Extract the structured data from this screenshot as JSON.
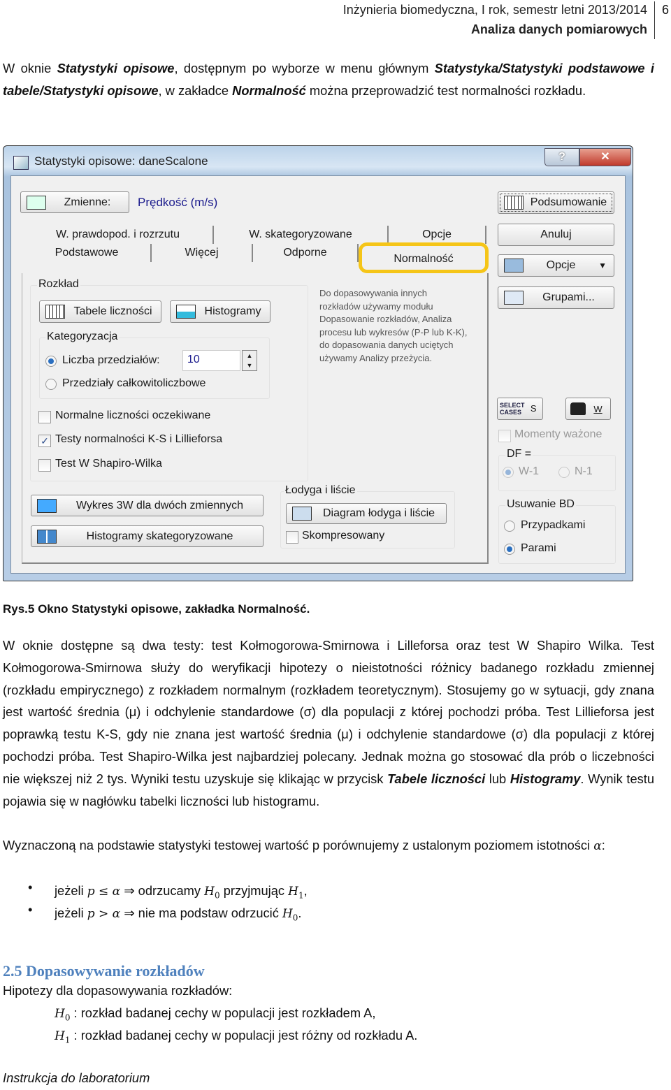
{
  "header": {
    "line1": "Inżynieria biomedyczna, I rok, semestr letni 2013/2014",
    "line2": "Analiza danych pomiarowych",
    "page_number": "6"
  },
  "para1": [
    "W oknie ",
    "Statystyki opisowe",
    ", dostępnym po wyborze w menu głównym ",
    "Statystyka/Statystyki podstawowe i tabele/Statystyki opisowe",
    ", w zakładce ",
    "Normalność",
    " można przeprowadzić test normalności rozkładu."
  ],
  "dialog": {
    "title": "Statystyki opisowe: daneScalone",
    "help": "?",
    "close": "✕",
    "variables_button": "Zmienne:",
    "variable_value": "Prędkość (m/s)",
    "tabs_row1": [
      "W. prawdopod. i rozrzutu",
      "W. skategoryzowane",
      "Opcje"
    ],
    "tabs_row2": [
      "Podstawowe",
      "Więcej",
      "Odporne",
      "Normalność"
    ],
    "active_tab": "Normalność",
    "highlight_color": "#f5c518",
    "group_distribution": "Rozkład",
    "freq_tables_button": "Tabele liczności",
    "histograms_button": "Histogramy",
    "group_categorization": "Kategoryzacja",
    "radio_intervals": "Liczba przedziałów:",
    "intervals_value": "10",
    "radio_integer": "Przedziały całkowitoliczbowe",
    "cb_expected": "Normalne liczności oczekiwane",
    "cb_expected_checked": false,
    "cb_ks": "Testy normalności  K-S i Lillieforsa",
    "cb_ks_checked": true,
    "cb_sw": "Test W Shapiro-Wilka",
    "cb_sw_checked": false,
    "info": "Do dopasowywania innych rozkładów używamy modułu Dopasowanie rozkładów, Analiza procesu lub wykresów (P-P lub K-K), do dopasowania danych uciętych używamy Analizy przeżycia.",
    "plot3d_button": "Wykres 3W  dla dwóch zmiennych",
    "cat_hist_button": "Histogramy skategoryzowane",
    "group_stem": "Łodyga i liście",
    "stem_button": "Diagram łodyga i liście",
    "cb_compressed": "Skompresowany",
    "summary_button": "Podsumowanie",
    "cancel_button": "Anuluj",
    "options_button": "Opcje",
    "bygroup_button": "Grupami...",
    "select_cases": [
      "SELECT",
      "CASES",
      "S"
    ],
    "weights_label": "W",
    "cb_moments": "Momenty ważone",
    "df_label": "DF =",
    "df_options": [
      "W-1",
      "N-1"
    ],
    "group_md": "Usuwanie BD",
    "md_options": [
      "Przypadkami",
      "Parami"
    ],
    "md_selected": "Parami"
  },
  "caption": "Rys.5 Okno Statystyki opisowe, zakładka Normalność.",
  "para2": [
    "W oknie dostępne są dwa testy: test Kołmogorowa-Smirnowa i Lilleforsa oraz test W Shapiro Wilka.  Test Kołmogorowa-Smirnowa służy do weryfikacji hipotezy o nieistotności różnicy badanego rozkładu zmiennej (rozkładu empirycznego) z rozkładem normalnym (rozkładem teoretycznym). Stosujemy go w sytuacji, gdy znana jest wartość średnia (μ) i odchylenie standardowe (σ) dla populacji z której pochodzi próba. Test Lillieforsa  jest poprawką testu K-S, gdy nie znana jest wartość średnia (μ) i odchylenie standardowe (σ) dla populacji z której pochodzi próba. Test Shapiro-Wilka jest najbardziej polecany. Jednak można go stosować dla prób o liczebności nie większej niż 2 tys. Wyniki testu uzyskuje się klikając w przycisk ",
    "Tabele liczności",
    " lub ",
    "Histogramy",
    ". Wynik testu pojawia się w nagłówku tabelki liczności lub histogramu."
  ],
  "para3": [
    "Wyznaczoną na podstawie statystyki testowej wartość p porównujemy z ustalonym poziomem istotności ",
    "α",
    ":"
  ],
  "bullets": [
    [
      "jeżeli ",
      "p ≤ α",
      " ⇒ odrzucamy ",
      "H",
      "0",
      " przyjmując ",
      "H",
      "1",
      ","
    ],
    [
      "jeżeli ",
      "p > α",
      " ⇒ nie ma podstaw odrzucić ",
      "H",
      "0",
      "."
    ]
  ],
  "section_heading": "2.5 Dopasowywanie rozkładów",
  "heading_color": "#4f81bd",
  "hypotheses_intro": "Hipotezy dla dopasowywania rozkładów:",
  "hypotheses": [
    {
      "sym": "H",
      "sub": "0",
      "text": " : rozkład badanej cechy w populacji jest rozkładem A,"
    },
    {
      "sym": "H",
      "sub": "1",
      "text": " : rozkład badanej cechy w populacji jest różny od rozkładu A."
    }
  ],
  "footer": "Instrukcja do laboratorium"
}
